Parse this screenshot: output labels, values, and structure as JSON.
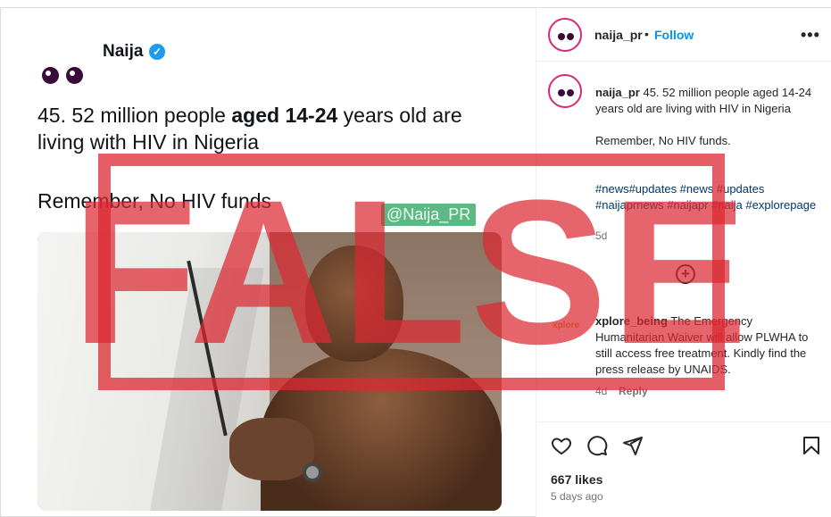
{
  "post_image": {
    "tweet_author": "Naija",
    "tweet_line1_pre": "45. 52 million people ",
    "tweet_line1_bold": "aged 14-24",
    "tweet_line1_post": " years old are living with HIV in Nigeria",
    "tweet_line2": "Remember, No HIV funds",
    "watermark": "@Naija_PR",
    "stamp": "FALSE"
  },
  "header": {
    "username": "naija_pr",
    "separator": "•",
    "follow_label": "Follow",
    "more_icon": "•••"
  },
  "caption": {
    "username": "naija_pr",
    "text": " 45. 52 million people aged 14-24 years old are living with HIV in Nigeria",
    "text2": "Remember, No HIV funds.",
    "hashtags": "#news#updates #news #updates #naijaprnews #naijapr #naija #explorepage",
    "age": "5d",
    "add_icon": "+"
  },
  "comment": {
    "avatar_text": "xplore",
    "username": "xplore_being",
    "text": " The Emergency Humanitarian Waiver will allow PLWHA to still access free treatment. Kindly find the press release by UNAIDS.",
    "age": "4d",
    "reply_label": "Reply"
  },
  "footer": {
    "likes": "667 likes",
    "posted": "5 days ago"
  }
}
